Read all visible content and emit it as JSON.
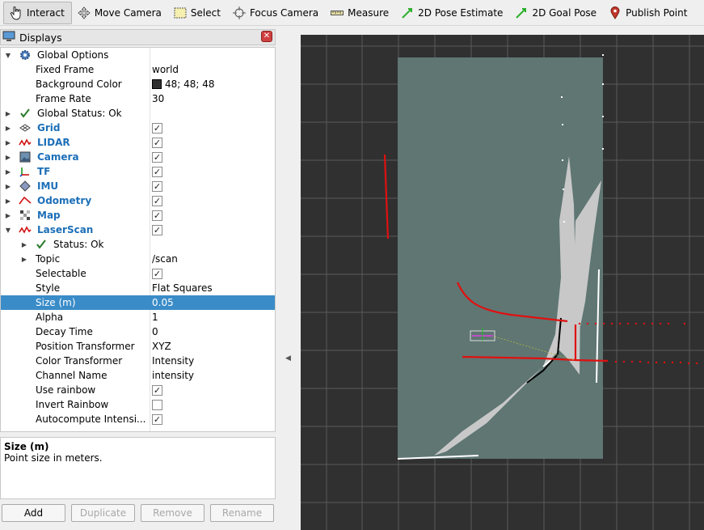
{
  "toolbar": {
    "interact": "Interact",
    "move_camera": "Move Camera",
    "select": "Select",
    "focus_camera": "Focus Camera",
    "measure": "Measure",
    "pose_estimate": "2D Pose Estimate",
    "goal_pose": "2D Goal Pose",
    "publish_point": "Publish Point"
  },
  "displays": {
    "title": "Displays",
    "global_options": "Global Options",
    "fixed_frame_label": "Fixed Frame",
    "fixed_frame_value": "world",
    "bg_color_label": "Background Color",
    "bg_color_value": "48; 48; 48",
    "frame_rate_label": "Frame Rate",
    "frame_rate_value": "30",
    "global_status": "Global Status: Ok",
    "items": {
      "grid": "Grid",
      "lidar": "LIDAR",
      "camera": "Camera",
      "tf": "TF",
      "imu": "IMU",
      "odometry": "Odometry",
      "map": "Map",
      "laserscan": "LaserScan"
    },
    "laserscan": {
      "status": "Status: Ok",
      "topic_label": "Topic",
      "topic_value": "/scan",
      "selectable_label": "Selectable",
      "style_label": "Style",
      "style_value": "Flat Squares",
      "size_label": "Size (m)",
      "size_value": "0.05",
      "alpha_label": "Alpha",
      "alpha_value": "1",
      "decay_label": "Decay Time",
      "decay_value": "0",
      "pos_tf_label": "Position Transformer",
      "pos_tf_value": "XYZ",
      "color_tf_label": "Color Transformer",
      "color_tf_value": "Intensity",
      "channel_label": "Channel Name",
      "channel_value": "intensity",
      "rainbow_label": "Use rainbow",
      "invert_label": "Invert Rainbow",
      "autocompute_label": "Autocompute Intensi..."
    }
  },
  "description": {
    "title": "Size (m)",
    "text": "Point size in meters."
  },
  "buttons": {
    "add": "Add",
    "duplicate": "Duplicate",
    "remove": "Remove",
    "rename": "Rename"
  },
  "colors": {
    "selection": "#3a8cc8",
    "accent_text": "#1c6fb8",
    "viewport_bg": "#303030",
    "map_fill": "#5f7673",
    "scan": "#e01010"
  }
}
